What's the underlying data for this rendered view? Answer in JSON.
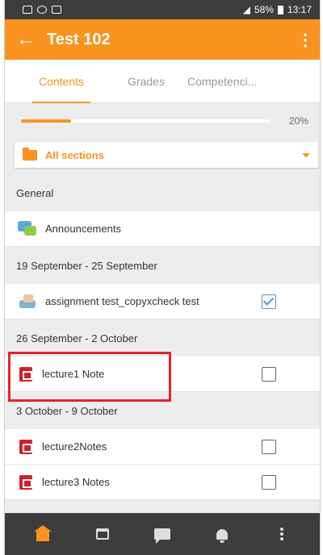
{
  "status_bar": {
    "battery": "58%",
    "time": "13:17"
  },
  "app_bar": {
    "back_icon": "arrow-left-icon",
    "title": "Test 102",
    "more_icon": "more-vert-icon"
  },
  "tabs": [
    {
      "label": "Contents",
      "active": true
    },
    {
      "label": "Grades",
      "active": false
    },
    {
      "label": "Competenci...",
      "active": false
    }
  ],
  "progress": {
    "value": 0.2,
    "label": "20%"
  },
  "section_selector": {
    "icon": "folder-icon",
    "selected": "All sections"
  },
  "sections": [
    {
      "header": "General",
      "items": [
        {
          "name": "Announcements",
          "icon": "forum-icon"
        }
      ]
    },
    {
      "header": "19 September - 25 September",
      "items": [
        {
          "name": "assignment test_copyxcheck test",
          "icon": "assignment-icon",
          "completion": "checked"
        }
      ]
    },
    {
      "header": "26 September - 2 October",
      "items": [
        {
          "name": "lecture1 Note",
          "icon": "pdf-icon",
          "completion": "unchecked"
        }
      ]
    },
    {
      "header": "3 October - 9 October",
      "items": [
        {
          "name": "lecture2Notes",
          "icon": "pdf-icon",
          "completion": "unchecked"
        },
        {
          "name": "lecture3 Notes",
          "icon": "pdf-icon",
          "completion": "unchecked"
        }
      ]
    }
  ],
  "colors": {
    "accent": "#f7931e",
    "highlight": "#e3232c",
    "check_blue": "#5b8fd6"
  },
  "bottom_nav": [
    {
      "icon": "home-icon",
      "active": true
    },
    {
      "icon": "calendar-icon",
      "active": false
    },
    {
      "icon": "messages-icon",
      "active": false
    },
    {
      "icon": "notifications-icon",
      "active": false
    },
    {
      "icon": "more-icon",
      "active": false
    }
  ]
}
